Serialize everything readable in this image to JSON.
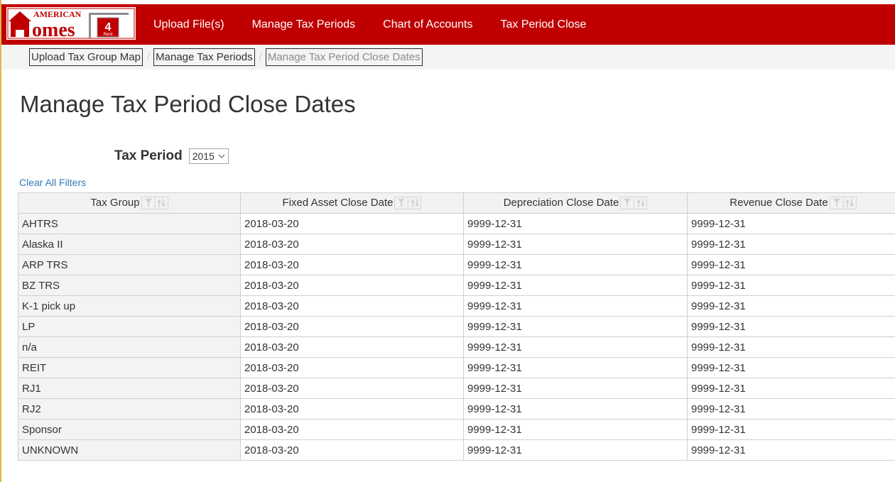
{
  "brand": {
    "logo_top": "AMERICAN",
    "logo_main": "Homes",
    "logo_badge": "4",
    "logo_badge_sub": "Rent",
    "primary_color": "#c00000"
  },
  "nav": {
    "items": [
      {
        "label": "Upload File(s)"
      },
      {
        "label": "Manage Tax Periods"
      },
      {
        "label": "Chart of Accounts"
      },
      {
        "label": "Tax Period Close"
      }
    ]
  },
  "breadcrumb": {
    "items": [
      {
        "label": "Upload Tax Group Map"
      },
      {
        "label": "Manage Tax Periods"
      },
      {
        "label": "Manage Tax Period Close Dates"
      }
    ],
    "separator": "/"
  },
  "page": {
    "title": "Manage Tax Period Close Dates",
    "tax_period_label": "Tax Period",
    "tax_period_value": "2015",
    "clear_filters": "Clear All Filters"
  },
  "table": {
    "columns": [
      {
        "label": "Tax Group"
      },
      {
        "label": "Fixed Asset Close Date"
      },
      {
        "label": "Depreciation Close Date"
      },
      {
        "label": "Revenue Close Date"
      }
    ],
    "rows": [
      [
        "AHTRS",
        "2018-03-20",
        "9999-12-31",
        "9999-12-31"
      ],
      [
        "Alaska II",
        "2018-03-20",
        "9999-12-31",
        "9999-12-31"
      ],
      [
        "ARP TRS",
        "2018-03-20",
        "9999-12-31",
        "9999-12-31"
      ],
      [
        "BZ TRS",
        "2018-03-20",
        "9999-12-31",
        "9999-12-31"
      ],
      [
        "K-1 pick up",
        "2018-03-20",
        "9999-12-31",
        "9999-12-31"
      ],
      [
        "LP",
        "2018-03-20",
        "9999-12-31",
        "9999-12-31"
      ],
      [
        "n/a",
        "2018-03-20",
        "9999-12-31",
        "9999-12-31"
      ],
      [
        "REIT",
        "2018-03-20",
        "9999-12-31",
        "9999-12-31"
      ],
      [
        "RJ1",
        "2018-03-20",
        "9999-12-31",
        "9999-12-31"
      ],
      [
        "RJ2",
        "2018-03-20",
        "9999-12-31",
        "9999-12-31"
      ],
      [
        "Sponsor",
        "2018-03-20",
        "9999-12-31",
        "9999-12-31"
      ],
      [
        "UNKNOWN",
        "2018-03-20",
        "9999-12-31",
        "9999-12-31"
      ]
    ]
  }
}
